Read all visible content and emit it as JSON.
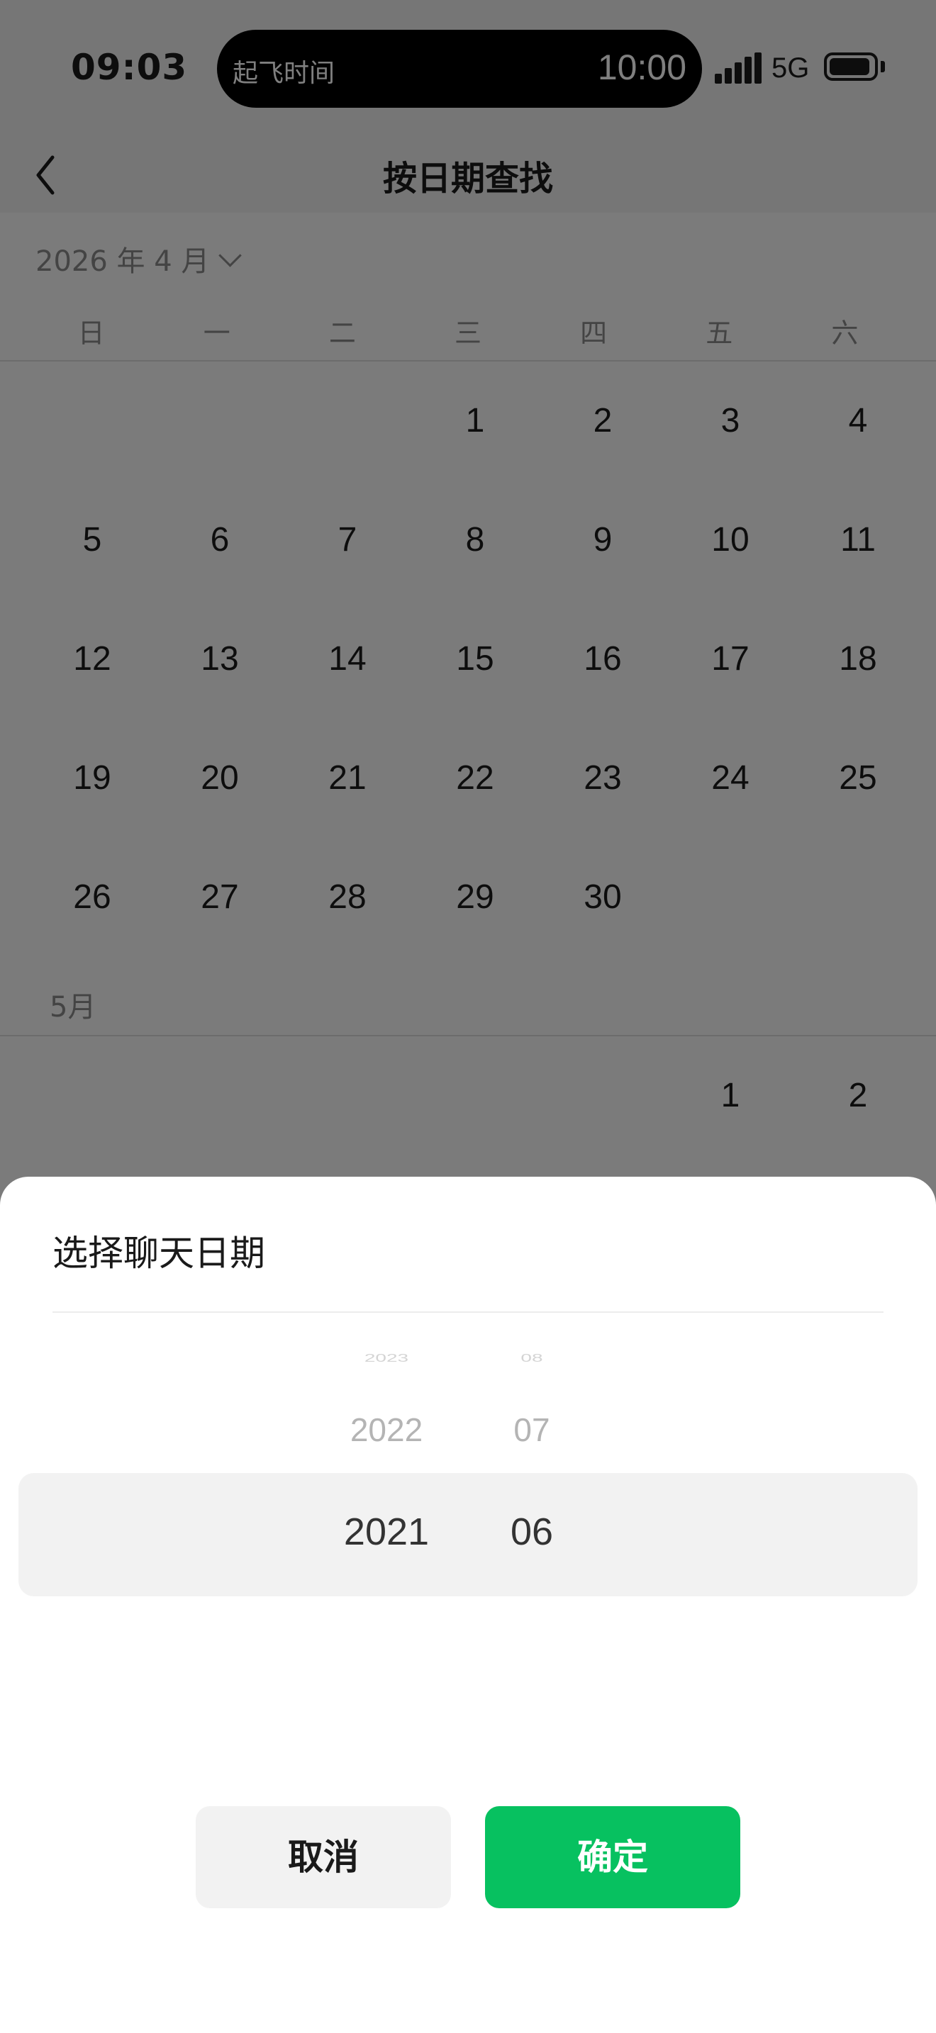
{
  "status_bar": {
    "time": "09:03",
    "island_label": "起飞时间",
    "island_value": "10:00",
    "network": "5G"
  },
  "nav": {
    "title": "按日期查找"
  },
  "calendar": {
    "month_selector": "2026 年 4 月",
    "weekdays": [
      "日",
      "一",
      "二",
      "三",
      "四",
      "五",
      "六"
    ],
    "april": [
      "",
      "",
      "",
      "1",
      "2",
      "3",
      "4",
      "5",
      "6",
      "7",
      "8",
      "9",
      "10",
      "11",
      "12",
      "13",
      "14",
      "15",
      "16",
      "17",
      "18",
      "19",
      "20",
      "21",
      "22",
      "23",
      "24",
      "25",
      "26",
      "27",
      "28",
      "29",
      "30"
    ],
    "may_label": "5月",
    "may": [
      "",
      "",
      "",
      "",
      "",
      "1",
      "2"
    ]
  },
  "sheet": {
    "title": "选择聊天日期",
    "year_picker": {
      "far": "2023",
      "near": "2022",
      "selected": "2021"
    },
    "month_picker": {
      "far": "08",
      "near": "07",
      "selected": "06"
    },
    "cancel_label": "取消",
    "confirm_label": "确定"
  },
  "colors": {
    "confirm": "#07c160",
    "overlay": "rgba(0,0,0,0.5)"
  }
}
